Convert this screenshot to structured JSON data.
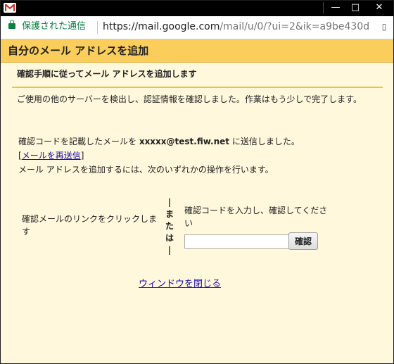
{
  "window": {
    "title_icon": "gmail-icon",
    "controls": {
      "minimize": "—",
      "maximize": "□",
      "close": "✕"
    }
  },
  "address_bar": {
    "secure_label": "保護された通信",
    "url_host": "https://mail.google.com",
    "url_path": "/mail/u/0/?ui=2&ik=a9be430d"
  },
  "page": {
    "title": "自分のメール アドレスを追加",
    "subheading": "確認手順に従ってメール アドレスを追加します",
    "intro": "ご使用の他のサーバーを検出し、認証情報を確認しました。作業はもう少しで完了します。",
    "sent_prefix": "確認コードを記載したメールを ",
    "sent_email": "xxxxx@test.fiw.net",
    "sent_suffix": " に送信しました。",
    "resend_link": "メールを再送信",
    "todo": "メール アドレスを追加するには、次のいずれかの操作を行います。",
    "option_link": "確認メールのリンクをクリックします",
    "or_label": "|または|",
    "option_code": "確認コードを入力し、確認してください",
    "code_value": "",
    "confirm_button": "確認",
    "close_window": "ウィンドウを閉じる"
  },
  "colors": {
    "header_bg": "#fbce5c",
    "body_bg": "#fff8dc",
    "rule": "#f1c232",
    "link": "#1a0dab",
    "secure_green": "#0b8043"
  }
}
